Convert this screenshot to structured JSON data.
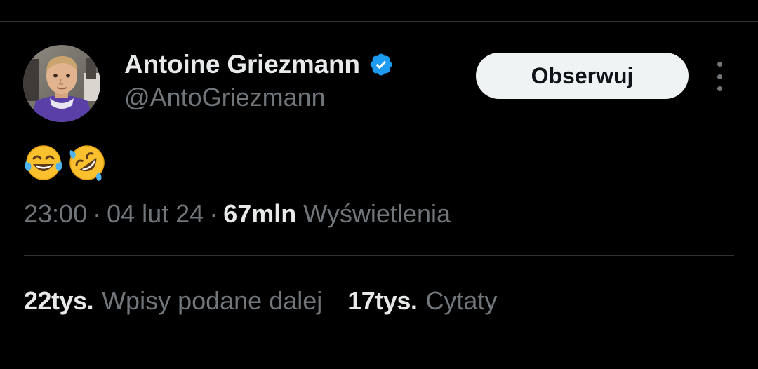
{
  "tweet": {
    "author": {
      "display_name": "Antoine Griezmann",
      "handle": "@AntoGriezmann",
      "verified_icon": "verified-badge-icon",
      "verified_color": "#1d9bf0"
    },
    "follow_label": "Obserwuj",
    "more_icon": "more-options-icon",
    "text_emojis": [
      "face-with-tears-of-joy",
      "rolling-on-the-floor-laughing"
    ],
    "time": "23:00",
    "date": "04 lut 24",
    "views_count": "67mln",
    "views_label": "Wyświetlenia",
    "stats": {
      "reposts_count": "22tys.",
      "reposts_label": "Wpisy podane dalej",
      "quotes_count": "17tys.",
      "quotes_label": "Cytaty"
    }
  },
  "colors": {
    "background": "#000000",
    "primary_text": "#e7e9ea",
    "secondary_text": "#71767b",
    "divider": "#2f3336",
    "follow_button_bg": "#eff3f4",
    "accent": "#1d9bf0"
  },
  "dot": "·"
}
